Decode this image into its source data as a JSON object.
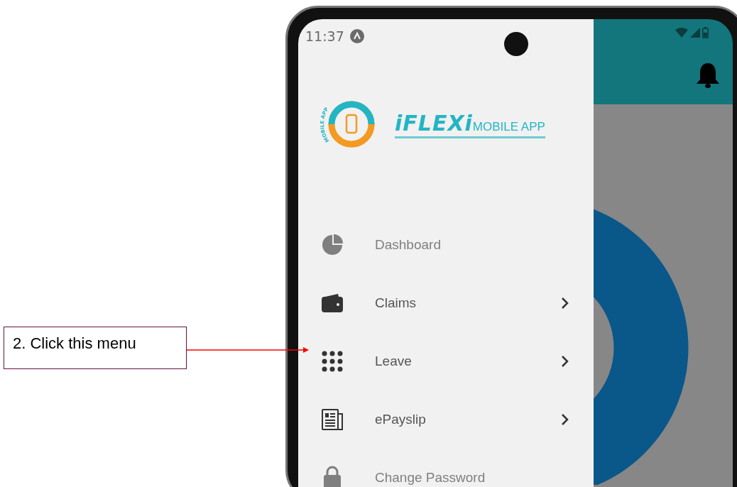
{
  "annotation": {
    "text": "2. Click this menu"
  },
  "status_bar": {
    "time": "11:37"
  },
  "logo": {
    "ring_text": "MOBILE APP",
    "brand": "iFLEXi",
    "tagline": "MOBILE APP"
  },
  "menu": [
    {
      "label": "Dashboard",
      "kind": "pie",
      "disabled": true,
      "expandable": false
    },
    {
      "label": "Claims",
      "kind": "wallet",
      "disabled": false,
      "expandable": true
    },
    {
      "label": "Leave",
      "kind": "grid",
      "disabled": false,
      "expandable": true
    },
    {
      "label": "ePayslip",
      "kind": "newspaper",
      "disabled": false,
      "expandable": true
    },
    {
      "label": "Change Password",
      "kind": "lock",
      "disabled": true,
      "expandable": false
    }
  ]
}
